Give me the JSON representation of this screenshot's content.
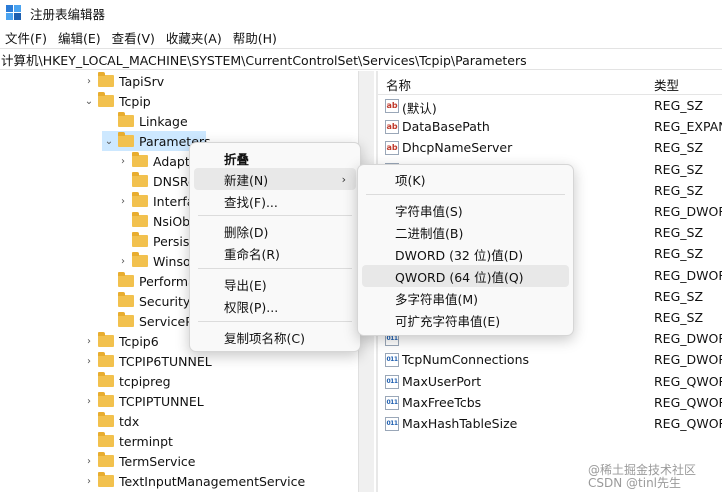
{
  "window": {
    "title": "注册表编辑器",
    "icon": "regedit-icon"
  },
  "menubar": [
    "文件(F)",
    "编辑(E)",
    "查看(V)",
    "收藏夹(A)",
    "帮助(H)"
  ],
  "address": "计算机\\HKEY_LOCAL_MACHINE\\SYSTEM\\CurrentControlSet\\Services\\Tcpip\\Parameters",
  "tree": [
    {
      "label": "TapiSrv",
      "chevron": "›"
    },
    {
      "label": "Tcpip",
      "chevron": "⌄"
    },
    {
      "label": "Linkage",
      "chevron": ""
    },
    {
      "label": "Parameters",
      "chevron": "⌄",
      "selected": true
    },
    {
      "label": "Adapters",
      "chevron": "›"
    },
    {
      "label": "DNSRegisteredAdapters",
      "chevron": ""
    },
    {
      "label": "Interfaces",
      "chevron": "›"
    },
    {
      "label": "NsiObjectSecurity",
      "chevron": ""
    },
    {
      "label": "PersistentRoutes",
      "chevron": ""
    },
    {
      "label": "Winsock",
      "chevron": "›"
    },
    {
      "label": "Performance",
      "chevron": ""
    },
    {
      "label": "Security",
      "chevron": ""
    },
    {
      "label": "ServiceProvider",
      "chevron": ""
    },
    {
      "label": "Tcpip6",
      "chevron": "›"
    },
    {
      "label": "TCPIP6TUNNEL",
      "chevron": "›"
    },
    {
      "label": "tcpipreg",
      "chevron": ""
    },
    {
      "label": "TCPIPTUNNEL",
      "chevron": "›"
    },
    {
      "label": "tdx",
      "chevron": ""
    },
    {
      "label": "terminpt",
      "chevron": ""
    },
    {
      "label": "TermService",
      "chevron": "›"
    },
    {
      "label": "TextInputManagementService",
      "chevron": "›"
    }
  ],
  "list": {
    "headers": {
      "name": "名称",
      "type": "类型"
    },
    "rows": [
      {
        "name": "(默认)",
        "type": "REG_SZ",
        "icon": "ab"
      },
      {
        "name": "DataBasePath",
        "type": "REG_EXPAND_SZ",
        "icon": "ab"
      },
      {
        "name": "DhcpNameServer",
        "type": "REG_SZ",
        "icon": "ab"
      },
      {
        "name": "",
        "type": "REG_SZ",
        "icon": "ab"
      },
      {
        "name": "",
        "type": "REG_SZ",
        "icon": "ab"
      },
      {
        "name": "",
        "type": "REG_DWORD",
        "icon": "bin"
      },
      {
        "name": "",
        "type": "REG_SZ",
        "icon": "ab"
      },
      {
        "name": "",
        "type": "REG_SZ",
        "icon": "ab"
      },
      {
        "name": "",
        "type": "REG_DWORD",
        "icon": "bin"
      },
      {
        "name": "",
        "type": "REG_SZ",
        "icon": "ab"
      },
      {
        "name": "",
        "type": "REG_SZ",
        "icon": "ab"
      },
      {
        "name": "",
        "type": "REG_DWORD",
        "icon": "bin"
      },
      {
        "name": "TcpNumConnections",
        "type": "REG_DWORD",
        "icon": "bin"
      },
      {
        "name": "MaxUserPort",
        "type": "REG_QWORD",
        "icon": "bin"
      },
      {
        "name": "MaxFreeTcbs",
        "type": "REG_QWORD",
        "icon": "bin"
      },
      {
        "name": "MaxHashTableSize",
        "type": "REG_QWORD",
        "icon": "bin"
      }
    ]
  },
  "context_menu": {
    "items": [
      "折叠",
      "新建(N)",
      "查找(F)...",
      "删除(D)",
      "重命名(R)",
      "导出(E)",
      "权限(P)...",
      "复制项名称(C)"
    ]
  },
  "submenu": {
    "items": [
      "项(K)",
      "字符串值(S)",
      "二进制值(B)",
      "DWORD (32 位)值(D)",
      "QWORD (64 位)值(Q)",
      "多字符串值(M)",
      "可扩充字符串值(E)"
    ]
  },
  "watermark": {
    "line1": "@稀土掘金技术社区",
    "line2": "CSDN @tinl先生"
  },
  "colors": {
    "selection": "#cde8ff",
    "folder": "#f2c14e",
    "hover": "#e8e8e8"
  }
}
